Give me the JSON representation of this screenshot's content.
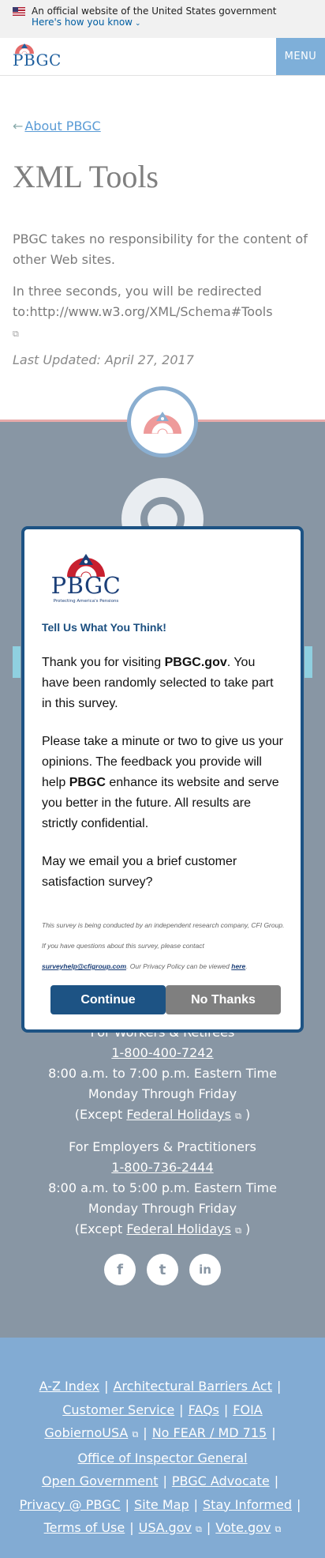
{
  "gov_banner": {
    "text": "An official website of the United States government",
    "how_link": "Here's how you know"
  },
  "header": {
    "logo_text": "PBGC",
    "menu_label": "MENU"
  },
  "main": {
    "back_link": "About PBGC",
    "title": "XML Tools",
    "disclaimer": "PBGC takes no responsibility for the content of other Web sites.",
    "redirect_prefix": "In three seconds, you will be redirected to:",
    "redirect_url": "http://www.w3.org/XML/Schema#Tools",
    "last_updated": "Last Updated: April 27, 2017"
  },
  "modal": {
    "logo_text": "PBGC",
    "logo_tagline": "Protecting America's Pensions",
    "heading": "Tell Us What You Think!",
    "p1_a": "Thank you for visiting ",
    "p1_strong": "PBGC.gov",
    "p1_b": ". You have been randomly selected to take part in this survey.",
    "p2_a": "Please take a minute or two to give us your opinions. The feedback you provide will help ",
    "p2_strong": "PBGC",
    "p2_b": " enhance its website and serve you better in the future. All results are strictly confidential.",
    "p3": "May we email you a brief customer satisfaction survey?",
    "small_a": "This survey is being conducted by an independent research company, CFI Group. If you have questions about this survey, please contact ",
    "small_email": "surveyhelp@cfigroup.com",
    "small_b": ". Our Privacy Policy can be viewed ",
    "small_here": "here",
    "small_c": ".",
    "continue_label": "Continue",
    "nothanks_label": "No Thanks"
  },
  "contact": {
    "workers_heading": "For Workers & Retirees",
    "workers_phone": "1-800-400-7242",
    "workers_hours": "8:00 a.m. to 7:00 p.m. Eastern Time Monday Through Friday",
    "except_prefix": "(Except ",
    "holidays_link": "Federal Holidays",
    "except_suffix": " )",
    "employers_heading": "For Employers & Practitioners",
    "employers_phone": "1-800-736-2444",
    "employers_hours": "8:00 a.m. to 5:00 p.m. Eastern Time Monday Through Friday"
  },
  "social": {
    "facebook": "f",
    "twitter": "t",
    "linkedin": "in"
  },
  "footer_links": {
    "az": "A-Z Index",
    "barriers": "Architectural Barriers Act",
    "customer": "Customer Service",
    "faqs": "FAQs",
    "foia": "FOIA",
    "gobierno": "GobiernoUSA",
    "nofear": "No FEAR / MD 715",
    "oig": "Office of Inspector General",
    "opengov": "Open Government",
    "advocate": "PBGC Advocate",
    "privacy": "Privacy @ PBGC",
    "sitemap": "Site Map",
    "stay": "Stay Informed",
    "terms": "Terms of Use",
    "usagov": "USA.gov",
    "vote": "Vote.gov",
    "separator": "|"
  },
  "icons": {
    "external": "⧉",
    "back_arrow": "←",
    "chevron": "⌄"
  },
  "colors": {
    "brand_blue": "#1d5384",
    "menu_blue": "#7eafd9",
    "footer_gray": "#8896a4",
    "links_blue": "#82abd3"
  }
}
